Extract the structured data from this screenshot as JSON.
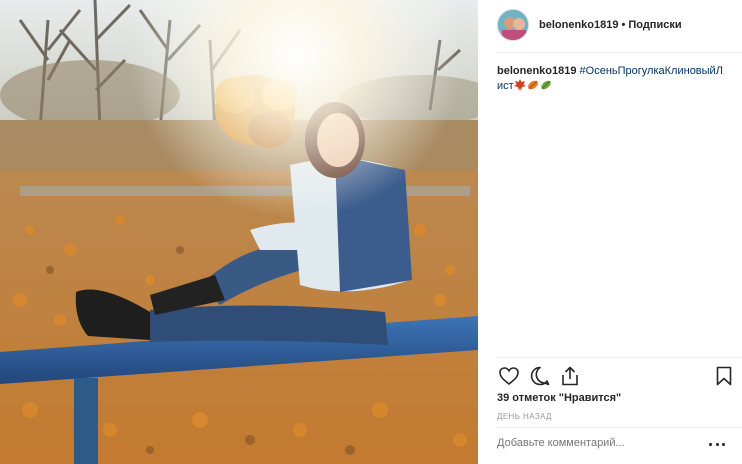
{
  "post": {
    "photo_alt": "photo",
    "author": {
      "username": "belonenko1819",
      "separator": "•",
      "follow_label": "Подписки"
    },
    "caption": {
      "username": "belonenko1819",
      "hashtag": "#ОсеньПрогулкаКлиновыйЛист"
    },
    "likes_text": "39 отметок \"Нравится\"",
    "timestamp": "день назад",
    "comment_placeholder": "Добавьте комментарий...",
    "icons": [
      "heart-icon",
      "comment-icon",
      "share-icon",
      "bookmark-icon",
      "more-icon",
      "maple-leaf-emoji",
      "fallen-leaf-emoji",
      "leaf-emoji"
    ]
  }
}
